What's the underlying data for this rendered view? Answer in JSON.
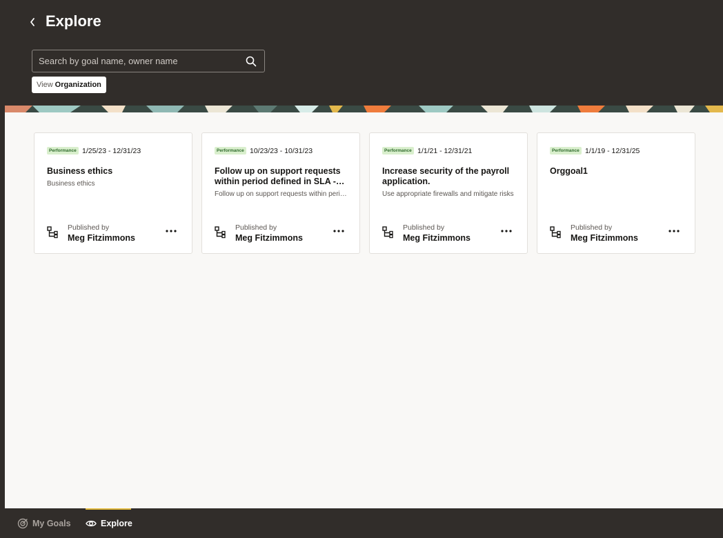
{
  "header": {
    "title": "Explore",
    "search": {
      "placeholder": "Search by goal name, owner name",
      "value": ""
    },
    "view_filter": {
      "label": "View",
      "value": "Organization"
    }
  },
  "cards": [
    {
      "badge": "Performance",
      "dates": "1/25/23 - 12/31/23",
      "title": "Business ethics",
      "description": "Business ethics",
      "published_label": "Published by",
      "publisher": "Meg Fitzimmons"
    },
    {
      "badge": "Performance",
      "dates": "10/23/23 - 10/31/23",
      "title": "Follow up on support requests within period defined in SLA - Service Level Agreement",
      "description": "Follow up on support requests within period defined in SLA",
      "published_label": "Published by",
      "publisher": "Meg Fitzimmons"
    },
    {
      "badge": "Performance",
      "dates": "1/1/21 - 12/31/21",
      "title": "Increase security of the payroll application.",
      "description": "Use appropriate firewalls and mitigate risks",
      "published_label": "Published by",
      "publisher": "Meg Fitzimmons"
    },
    {
      "badge": "Performance",
      "dates": "1/1/19 - 12/31/25",
      "title": "Orggoal1",
      "description": "",
      "published_label": "Published by",
      "publisher": "Meg Fitzimmons"
    }
  ],
  "bottom_nav": {
    "tabs": [
      {
        "label": "My Goals",
        "icon": "target-icon",
        "active": false
      },
      {
        "label": "Explore",
        "icon": "eye-icon",
        "active": true
      }
    ]
  },
  "colors": {
    "header_bg": "#312d2a",
    "content_bg": "#f9f8f6",
    "badge_bg": "#d9efcd",
    "active_tab_indicator": "#e2b93b"
  }
}
